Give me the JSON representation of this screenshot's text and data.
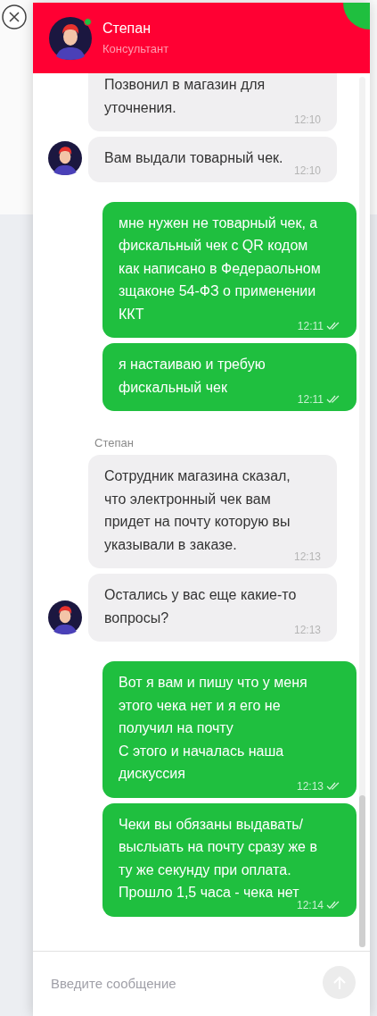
{
  "header": {
    "name": "Степан",
    "role": "Консультант",
    "online": true
  },
  "messages": [
    {
      "kind": "agent",
      "text": "Позвонил в магазин для уточнения.",
      "time": "12:10",
      "avatar": false
    },
    {
      "kind": "agent",
      "text": "Вам выдали товарный чек.",
      "time": "12:10",
      "avatar": true
    },
    {
      "kind": "user",
      "text": "мне нужен не товарный чек, а фискальный чек с QR кодом как написано в Федераольном зщаконе 54-ФЗ о применении ККТ",
      "time": "12:11",
      "read": true
    },
    {
      "kind": "user",
      "text": "я настаиваю и требую фискальный чек",
      "time": "12:11",
      "read": true
    },
    {
      "kind": "sender",
      "text": "Степан"
    },
    {
      "kind": "agent",
      "text": "Сотрудник магазина сказал, что электронный чек вам придет на почту которую вы указывали в заказе.",
      "time": "12:13",
      "avatar": false
    },
    {
      "kind": "agent",
      "text": "Остались у вас еще какие-то вопросы?",
      "time": "12:13",
      "avatar": true
    },
    {
      "kind": "user",
      "text": "Вот я вам и пишу что у меня этого чека нет и я его не получил на почту\nС этого и началась наша дискуссия",
      "time": "12:13",
      "read": true
    },
    {
      "kind": "user",
      "text": "Чеки вы обязаны выдавать/ выслыать на почту сразу же в ту же секунду при оплата. Прошло 1,5 часа - чека нет",
      "time": "12:14",
      "read": true
    }
  ],
  "composer": {
    "placeholder": "Введите сообщение"
  }
}
